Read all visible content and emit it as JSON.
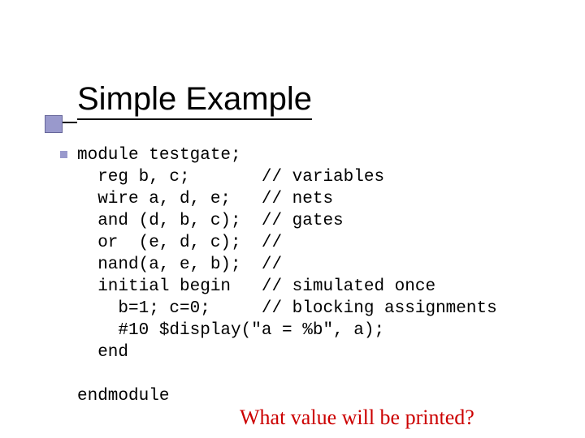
{
  "title": "Simple Example",
  "code": "module testgate;\n  reg b, c;       // variables\n  wire a, d, e;   // nets\n  and (d, b, c);  // gates\n  or  (e, d, c);  //\n  nand(a, e, b);  //\n  initial begin   // simulated once\n    b=1; c=0;     // blocking assignments\n    #10 $display(\"a = %b\", a);\n  end\n\nendmodule",
  "question": "What value will be printed?"
}
